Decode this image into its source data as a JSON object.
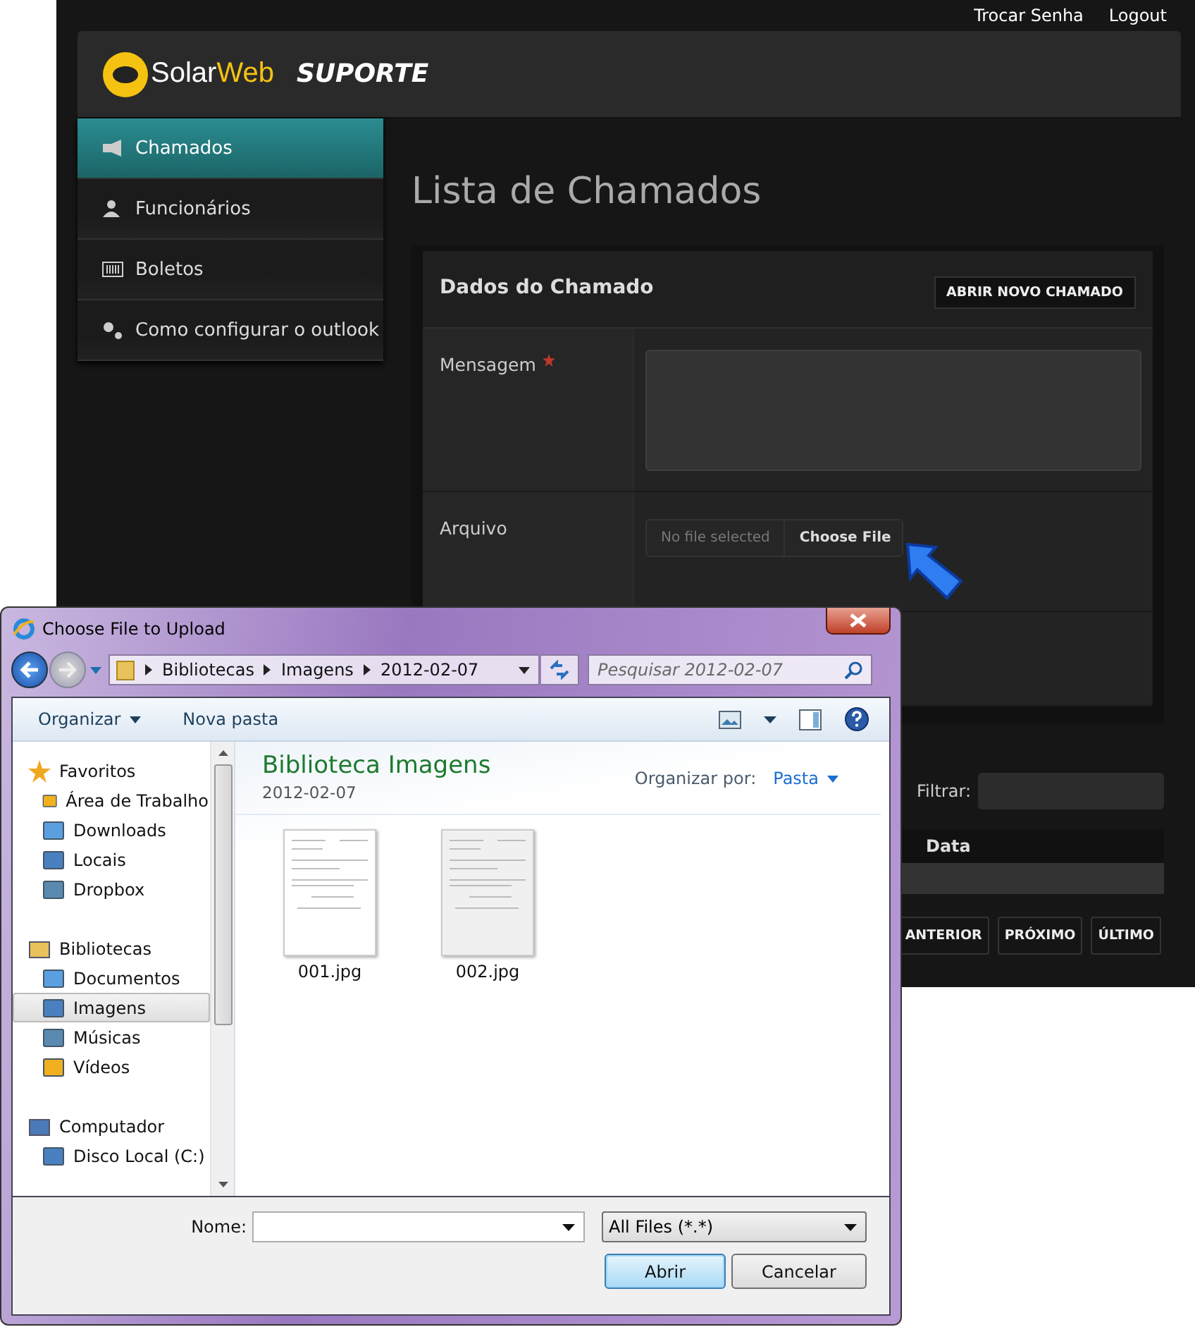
{
  "top_links": [
    {
      "label": "Trocar Senha"
    },
    {
      "label": "Logout"
    }
  ],
  "header": {
    "logo_part_1": "Solar",
    "logo_part_2": "Web",
    "subtitle": "SUPORTE"
  },
  "sidebar": {
    "items": [
      {
        "label": "Chamados",
        "selected": true
      },
      {
        "label": "Funcionários",
        "selected": false
      },
      {
        "label": "Boletos",
        "selected": false
      },
      {
        "label": "Como configurar o outlook",
        "selected": false
      }
    ]
  },
  "page_title": "Lista de Chamados",
  "form": {
    "title": "Dados do Chamado",
    "action_button": "ABRIR NOVO CHAMADO",
    "fields": [
      {
        "kind": "textarea",
        "label": "Mensagem",
        "required": true
      },
      {
        "kind": "file",
        "label": "Arquivo",
        "required": false,
        "file_status": "No file selected",
        "button": "Choose File"
      }
    ]
  },
  "filter": {
    "label": "Filtrar:"
  },
  "table": {
    "columns": [
      "Data"
    ]
  },
  "pagination": [
    "ANTERIOR",
    "PRÓXIMO",
    "ÚLTIMO"
  ],
  "dialog": {
    "title": "Choose File to Upload",
    "breadcrumb": [
      "Bibliotecas",
      "Imagens",
      "2012-02-07"
    ],
    "search": {
      "placeholder": "Pesquisar 2012-02-07"
    },
    "toolbar": {
      "organize": "Organizar",
      "new_folder": "Nova pasta"
    },
    "nav": [
      {
        "label": "Favoritos",
        "selected": false,
        "children": [
          {
            "label": "Área de Trabalho",
            "selected": false
          },
          {
            "label": "Downloads",
            "selected": false
          },
          {
            "label": "Locais",
            "selected": false
          },
          {
            "label": "Dropbox",
            "selected": false
          }
        ]
      },
      {
        "label": "Bibliotecas",
        "selected": false,
        "children": [
          {
            "label": "Documentos",
            "selected": false
          },
          {
            "label": "Imagens",
            "selected": true
          },
          {
            "label": "Músicas",
            "selected": false
          },
          {
            "label": "Vídeos",
            "selected": false
          }
        ]
      },
      {
        "label": "Computador",
        "selected": false,
        "children": [
          {
            "label": "Disco Local (C:)",
            "selected": false
          }
        ]
      }
    ],
    "library": {
      "title": "Biblioteca Imagens",
      "subtitle": "2012-02-07",
      "arrange_label": "Organizar por:",
      "arrange_value": "Pasta"
    },
    "files": [
      {
        "name": "001.jpg"
      },
      {
        "name": "002.jpg"
      }
    ],
    "filename_label": "Nome:",
    "file_type": "All Files (*.*)",
    "buttons": [
      {
        "label": "Abrir",
        "kind": "primary"
      },
      {
        "label": "Cancelar",
        "kind": "secondary"
      }
    ]
  }
}
